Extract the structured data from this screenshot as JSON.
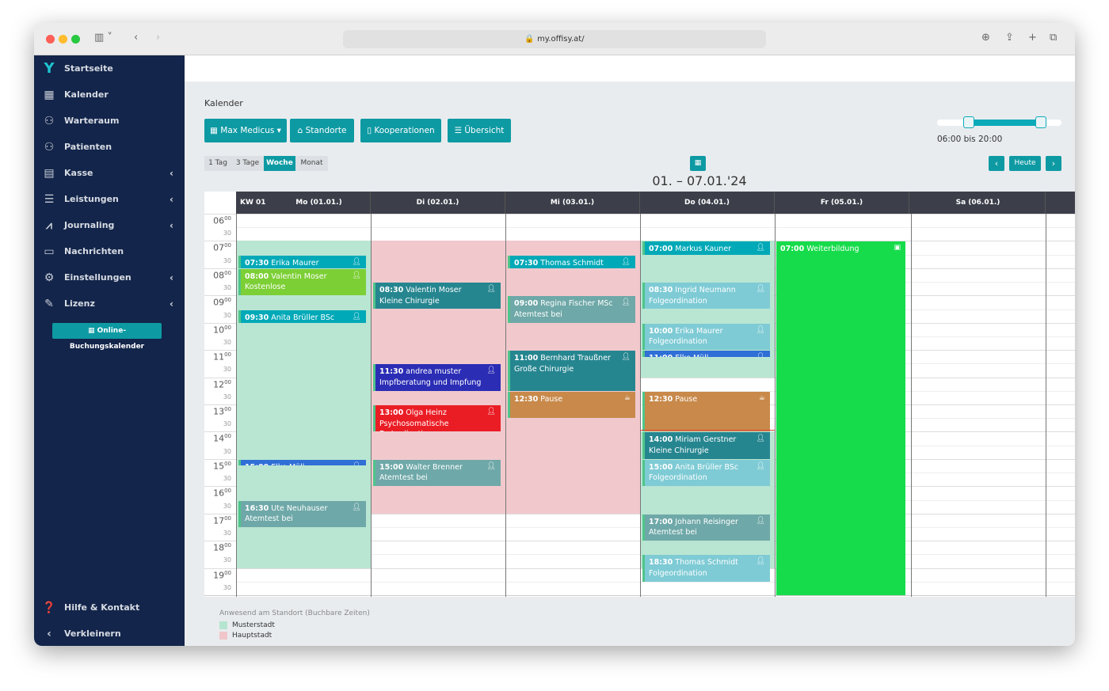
{
  "browser": {
    "url": "my.offisy.at/"
  },
  "sidebar": {
    "items": [
      {
        "label": "Startseite",
        "icon": "logo-icon",
        "chevron": false
      },
      {
        "label": "Kalender",
        "icon": "calendar-icon",
        "chevron": false
      },
      {
        "label": "Warteraum",
        "icon": "waiting-room-icon",
        "chevron": false
      },
      {
        "label": "Patienten",
        "icon": "patients-icon",
        "chevron": false
      },
      {
        "label": "Kasse",
        "icon": "cash-register-icon",
        "chevron": true
      },
      {
        "label": "Leistungen",
        "icon": "list-icon",
        "chevron": true
      },
      {
        "label": "Journaling",
        "icon": "chart-icon",
        "chevron": true
      },
      {
        "label": "Nachrichten",
        "icon": "messages-icon",
        "chevron": false
      },
      {
        "label": "Einstellungen",
        "icon": "gear-icon",
        "chevron": true
      },
      {
        "label": "Lizenz",
        "icon": "license-icon",
        "chevron": true
      }
    ],
    "booking_button": "Online-Buchungskalender",
    "help": "Hilfe & Kontakt",
    "collapse": "Verkleinern"
  },
  "page": {
    "title": "Kalender",
    "buttons": {
      "user": "Max Medicus",
      "locations": "Standorte",
      "cooperations": "Kooperationen",
      "overview": "Übersicht"
    },
    "views": [
      "1 Tag",
      "3 Tage",
      "Woche",
      "Monat"
    ],
    "active_view": "Woche",
    "range_label": "06:00 bis 20:00",
    "range_start_hour": 6,
    "range_end_hour": 20,
    "today": "Heute",
    "date_range": "01. – 07.01.'24"
  },
  "calendar": {
    "week": "KW 01",
    "days": [
      "Mo (01.01.)",
      "Di (02.01.)",
      "Mi (03.01.)",
      "Do (04.01.)",
      "Fr (05.01.)",
      "Sa (06.01.)"
    ],
    "hours": [
      "06",
      "07",
      "08",
      "09",
      "10",
      "11",
      "12",
      "13",
      "14",
      "15",
      "16",
      "17",
      "18",
      "19"
    ],
    "minute_labels": {
      "full": "00",
      "half": "30"
    },
    "zones": [
      {
        "day": 0,
        "start": 7,
        "end": 19,
        "location": "Musterstadt"
      },
      {
        "day": 1,
        "start": 7,
        "end": 17,
        "location": "Hauptstadt"
      },
      {
        "day": 2,
        "start": 7,
        "end": 17,
        "location": "Hauptstadt"
      },
      {
        "day": 3,
        "start": 7,
        "end": 12,
        "location": "Musterstadt"
      },
      {
        "day": 3,
        "start": 14,
        "end": 19,
        "location": "Musterstadt"
      }
    ],
    "current_time": {
      "day": 3,
      "hour": 13.93
    },
    "events": [
      {
        "day": 0,
        "start": 7.5,
        "end": 8,
        "time": "07:30",
        "name": "Erika Maurer",
        "sub": "",
        "color": "#00a9b8",
        "icon": "person"
      },
      {
        "day": 0,
        "start": 8,
        "end": 9,
        "time": "08:00",
        "name": "Valentin Moser",
        "sub": "Kostenlose",
        "color": "#7ccf35",
        "icon": "person"
      },
      {
        "day": 0,
        "start": 9.5,
        "end": 10,
        "time": "09:30",
        "name": "Anita Brüller BSc",
        "sub": "",
        "color": "#00a9b8",
        "icon": "person"
      },
      {
        "day": 0,
        "start": 15,
        "end": 15.25,
        "time": "15:00",
        "name": "Elke Müll",
        "sub": "",
        "color": "#2f6fd6",
        "icon": "person"
      },
      {
        "day": 0,
        "start": 16.5,
        "end": 17.5,
        "time": "16:30",
        "name": "Ute Neuhauser",
        "sub": "Atemtest bei",
        "color": "#6fa8a8",
        "icon": "person"
      },
      {
        "day": 1,
        "start": 8.5,
        "end": 9.5,
        "time": "08:30",
        "name": "Valentin Moser",
        "sub": "Kleine Chirurgie",
        "color": "#268690",
        "icon": "person"
      },
      {
        "day": 1,
        "start": 11.5,
        "end": 12.5,
        "time": "11:30",
        "name": "andrea muster",
        "sub": "Impfberatung und Impfung",
        "color": "#2b2db5",
        "icon": "person"
      },
      {
        "day": 1,
        "start": 13,
        "end": 14,
        "time": "13:00",
        "name": "Olga Heinz",
        "sub": "Psychosomatische Erstordination",
        "color": "#ea1d25",
        "icon": "person"
      },
      {
        "day": 1,
        "start": 15,
        "end": 16,
        "time": "15:00",
        "name": "Walter Brenner",
        "sub": "Atemtest bei",
        "color": "#6fa8a8",
        "icon": "person"
      },
      {
        "day": 2,
        "start": 7.5,
        "end": 8,
        "time": "07:30",
        "name": "Thomas Schmidt",
        "sub": "",
        "color": "#00a9b8",
        "icon": "person"
      },
      {
        "day": 2,
        "start": 9,
        "end": 10,
        "time": "09:00",
        "name": "Regina Fischer MSc",
        "sub": "Atemtest bei",
        "color": "#6fa8a8",
        "icon": "person"
      },
      {
        "day": 2,
        "start": 11,
        "end": 12.5,
        "time": "11:00",
        "name": "Bernhard Traußner",
        "sub": "Große Chirurgie",
        "color": "#268690",
        "icon": "person"
      },
      {
        "day": 2,
        "start": 12.5,
        "end": 13.5,
        "time": "12:30",
        "name": "Pause",
        "sub": "",
        "color": "#c8894a",
        "icon": "coffee"
      },
      {
        "day": 3,
        "start": 7,
        "end": 7.5,
        "time": "07:00",
        "name": "Markus Kauner",
        "sub": "",
        "color": "#00a9b8",
        "icon": "person"
      },
      {
        "day": 3,
        "start": 8.5,
        "end": 9.5,
        "time": "08:30",
        "name": "Ingrid Neumann",
        "sub": "Folgeordination",
        "color": "#7ecbd5",
        "icon": "person"
      },
      {
        "day": 3,
        "start": 10,
        "end": 11,
        "time": "10:00",
        "name": "Erika Maurer",
        "sub": "Folgeordination",
        "color": "#7ecbd5",
        "icon": "person"
      },
      {
        "day": 3,
        "start": 11,
        "end": 11.25,
        "time": "11:00",
        "name": "Elke Müll",
        "sub": "",
        "color": "#2f6fd6",
        "icon": "person"
      },
      {
        "day": 3,
        "start": 12.5,
        "end": 14,
        "time": "12:30",
        "name": "Pause",
        "sub": "",
        "color": "#c8894a",
        "icon": "coffee"
      },
      {
        "day": 3,
        "start": 14,
        "end": 15,
        "time": "14:00",
        "name": "Miriam Gerstner",
        "sub": "Kleine Chirurgie",
        "color": "#268690",
        "icon": "person"
      },
      {
        "day": 3,
        "start": 15,
        "end": 16,
        "time": "15:00",
        "name": "Anita Brüller BSc",
        "sub": "Folgeordination",
        "color": "#7ecbd5",
        "icon": "person"
      },
      {
        "day": 3,
        "start": 17,
        "end": 18,
        "time": "17:00",
        "name": "Johann Reisinger",
        "sub": "Atemtest bei",
        "color": "#6fa8a8",
        "icon": "person"
      },
      {
        "day": 3,
        "start": 18.5,
        "end": 19.5,
        "time": "18:30",
        "name": "Thomas Schmidt",
        "sub": "Folgeordination",
        "color": "#7ecbd5",
        "icon": "person"
      },
      {
        "day": 4,
        "start": 7,
        "end": 20,
        "time": "07:00",
        "name": "Weiterbildung",
        "sub": "",
        "color": "#16dc4b",
        "icon": "calendar",
        "full": true
      }
    ]
  },
  "legend": {
    "title": "Anwesend am Standort (Buchbare Zeiten)",
    "items": [
      {
        "label": "Musterstadt",
        "color": "#b5e5d0"
      },
      {
        "label": "Hauptstadt",
        "color": "#f0c6ca"
      }
    ]
  },
  "colors": {
    "sidebar": "#13254a",
    "accent": "#0e9aa3",
    "header": "#3c3f4a"
  }
}
